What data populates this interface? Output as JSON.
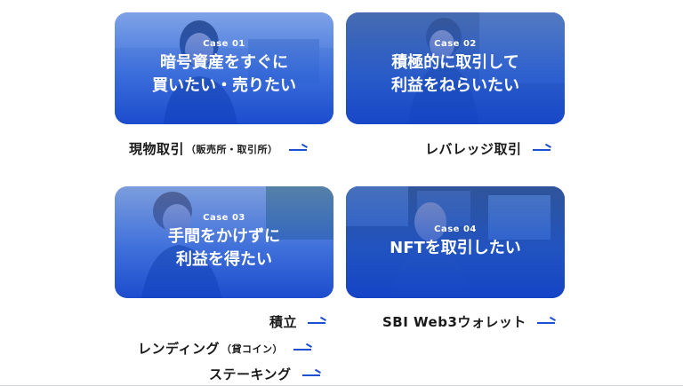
{
  "cards": [
    {
      "case": "Case 01",
      "title": "暗号資産をすぐに\n買いたい・売りたい",
      "theme": "#2a63d6"
    },
    {
      "case": "Case 02",
      "title": "積極的に取引して\n利益をねらいたい",
      "theme": "#2a63d6"
    },
    {
      "case": "Case 03",
      "title": "手間をかけずに\n利益を得たい",
      "theme": "#2a63d6"
    },
    {
      "case": "Case 04",
      "title": "NFTを取引したい",
      "theme": "#2a63d6"
    }
  ],
  "links": {
    "spot": {
      "label": "現物取引",
      "sub": "（販売所・取引所）"
    },
    "leverage": {
      "label": "レバレッジ取引"
    },
    "tsumitate": {
      "label": "積立"
    },
    "lending": {
      "label": "レンディング",
      "sub": "（貸コイン）"
    },
    "staking": {
      "label": "ステーキング"
    },
    "wallet": {
      "label": "SBI Web3ウォレット"
    }
  },
  "colors": {
    "accent": "#1f4fd1",
    "card_overlay": "#2a63d6",
    "text": "#1a1a1a"
  },
  "icons": {
    "arrow": "arrow-right-icon"
  }
}
